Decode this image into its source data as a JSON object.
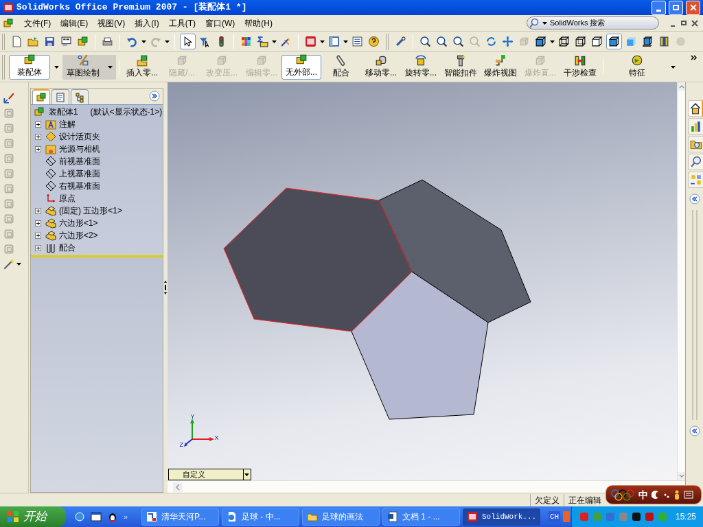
{
  "window": {
    "title": "SolidWorks Office Premium 2007 - [装配体1 *]"
  },
  "menu": [
    "文件(F)",
    "编辑(E)",
    "视图(V)",
    "插入(I)",
    "工具(T)",
    "窗口(W)",
    "帮助(H)"
  ],
  "search": {
    "label": "SolidWorks 搜索"
  },
  "command_manager": {
    "tabs": [
      {
        "label": "装配体",
        "selected": true
      },
      {
        "label": "草图绘制",
        "selected": false
      }
    ],
    "buttons": [
      {
        "label": "插入零...",
        "disabled": false,
        "pressed": false
      },
      {
        "label": "隐藏/...",
        "disabled": true,
        "pressed": false
      },
      {
        "label": "改变压...",
        "disabled": true,
        "pressed": false
      },
      {
        "label": "编辑零...",
        "disabled": true,
        "pressed": false
      },
      {
        "label": "无外部...",
        "disabled": false,
        "pressed": true
      },
      {
        "label": "配合",
        "disabled": false,
        "pressed": false
      },
      {
        "label": "移动零...",
        "disabled": false,
        "pressed": false
      },
      {
        "label": "旋转零...",
        "disabled": false,
        "pressed": false
      },
      {
        "label": "智能扣件",
        "disabled": false,
        "pressed": false
      },
      {
        "label": "爆炸视图",
        "disabled": false,
        "pressed": false
      },
      {
        "label": "爆炸直...",
        "disabled": true,
        "pressed": false
      },
      {
        "label": "干涉检查",
        "disabled": false,
        "pressed": false
      },
      {
        "label": "特征",
        "disabled": false,
        "pressed": false
      }
    ]
  },
  "feature_manager": {
    "tabs": [
      {
        "selected": true
      },
      {
        "selected": false
      },
      {
        "selected": false
      }
    ],
    "root": {
      "label": "装配体1",
      "configuration": "(默认<显示状态-1>)"
    },
    "items": [
      {
        "kind": "annotation",
        "label": "注解",
        "expandable": true
      },
      {
        "kind": "binder",
        "label": "设计活页夹",
        "expandable": true
      },
      {
        "kind": "lights",
        "label": "光源与相机",
        "expandable": true
      },
      {
        "kind": "plane",
        "label": "前视基准面",
        "expandable": false
      },
      {
        "kind": "plane",
        "label": "上视基准面",
        "expandable": false
      },
      {
        "kind": "plane",
        "label": "右视基准面",
        "expandable": false
      },
      {
        "kind": "origin",
        "label": "原点",
        "expandable": false
      },
      {
        "kind": "part",
        "label": "(固定) 五边形<1>",
        "expandable": true
      },
      {
        "kind": "part",
        "label": "六边形<1>",
        "expandable": true
      },
      {
        "kind": "part",
        "label": "六边形<2>",
        "expandable": true
      },
      {
        "kind": "mates",
        "label": "配合",
        "expandable": true
      }
    ]
  },
  "viewport": {
    "axis_labels": [
      "Y",
      "X",
      "Z"
    ],
    "display_state": "自定义"
  },
  "status_bar": [
    "欠定义",
    "正在编辑"
  ],
  "ime_bar": {
    "label": "中"
  },
  "taskbar": {
    "start": "开始",
    "more": "»",
    "tasks": [
      {
        "label": "清华天河P...",
        "selected": false
      },
      {
        "label": "足球 - 中...",
        "selected": false
      },
      {
        "label": "足球的画法",
        "selected": false
      },
      {
        "label": "文档 1 - ...",
        "selected": false
      },
      {
        "label": "SolidWork...",
        "selected": true
      }
    ],
    "language": "CH",
    "clock": "15:25"
  }
}
